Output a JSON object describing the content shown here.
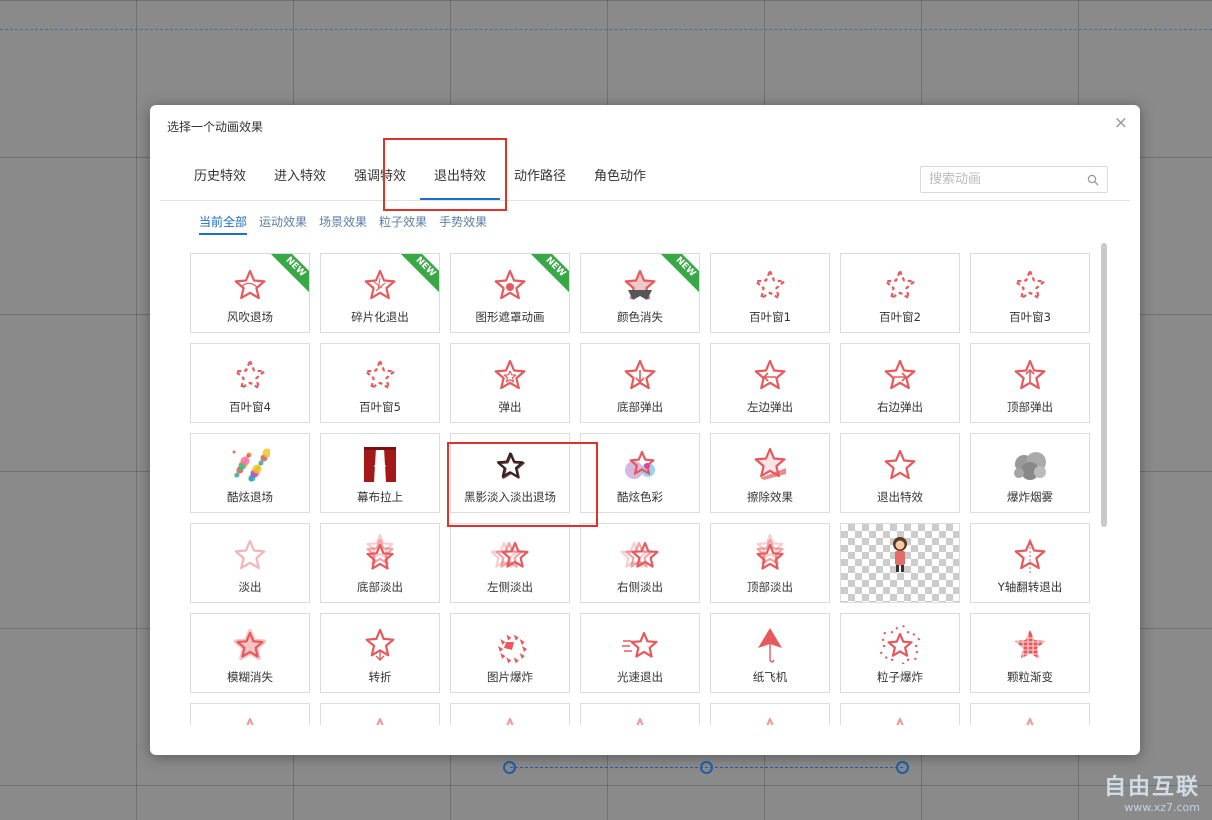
{
  "dialog": {
    "title": "选择一个动画效果",
    "close_glyph": "×",
    "tabs": [
      {
        "label": "历史特效",
        "active": false
      },
      {
        "label": "进入特效",
        "active": false
      },
      {
        "label": "强调特效",
        "active": false
      },
      {
        "label": "退出特效",
        "active": true
      },
      {
        "label": "动作路径",
        "active": false
      },
      {
        "label": "角色动作",
        "active": false
      }
    ],
    "search": {
      "placeholder": "搜索动画"
    },
    "subtabs": [
      {
        "label": "当前全部",
        "active": true
      },
      {
        "label": "运动效果",
        "active": false
      },
      {
        "label": "场景效果",
        "active": false
      },
      {
        "label": "粒子效果",
        "active": false
      },
      {
        "label": "手势效果",
        "active": false
      }
    ],
    "effects": [
      {
        "label": "风吹退场",
        "icon": "blown-star-icon",
        "new": true,
        "style": "blown"
      },
      {
        "label": "碎片化退出",
        "icon": "shattered-star-icon",
        "new": true,
        "style": "shatter"
      },
      {
        "label": "图形遮罩动画",
        "icon": "mask-star-icon",
        "new": true,
        "style": "dot"
      },
      {
        "label": "颜色消失",
        "icon": "color-fade-star-icon",
        "new": true,
        "style": "darkbottom"
      },
      {
        "label": "百叶窗1",
        "icon": "blinds-star-icon",
        "new": false,
        "style": "dashed"
      },
      {
        "label": "百叶窗2",
        "icon": "blinds-star-icon",
        "new": false,
        "style": "dashed"
      },
      {
        "label": "百叶窗3",
        "icon": "blinds-star-icon",
        "new": false,
        "style": "dashed"
      },
      {
        "label": "百叶窗4",
        "icon": "blinds-star-icon",
        "new": false,
        "style": "dashed"
      },
      {
        "label": "百叶窗5",
        "icon": "blinds-star-icon",
        "new": false,
        "style": "dashed"
      },
      {
        "label": "弹出",
        "icon": "popup-star-icon",
        "new": false,
        "style": "inner"
      },
      {
        "label": "底部弹出",
        "icon": "arrow-down-star-icon",
        "new": false,
        "style": "arrowdown"
      },
      {
        "label": "左边弹出",
        "icon": "arrow-left-star-icon",
        "new": false,
        "style": "arrowleft"
      },
      {
        "label": "右边弹出",
        "icon": "arrow-right-star-icon",
        "new": false,
        "style": "arrowright"
      },
      {
        "label": "顶部弹出",
        "icon": "arrow-up-star-icon",
        "new": false,
        "style": "arrowup"
      },
      {
        "label": "酷炫退场",
        "icon": "colorful-dots-icon",
        "new": false,
        "style": "dots"
      },
      {
        "label": "幕布拉上",
        "icon": "curtain-icon",
        "new": false,
        "style": "curtain"
      },
      {
        "label": "黑影淡入淡出退场",
        "icon": "shadow-star-icon",
        "new": false,
        "style": "shadow"
      },
      {
        "label": "酷炫色彩",
        "icon": "colorful-star-icon",
        "new": false,
        "style": "colorful"
      },
      {
        "label": "擦除效果",
        "icon": "wipe-star-icon",
        "new": false,
        "style": "wipe"
      },
      {
        "label": "退出特效",
        "icon": "exit-star-icon",
        "new": false,
        "style": "plain"
      },
      {
        "label": "爆炸烟雾",
        "icon": "smoke-explosion-icon",
        "new": false,
        "style": "smoke"
      },
      {
        "label": "淡出",
        "icon": "faded-star-icon",
        "new": false,
        "style": "faded"
      },
      {
        "label": "底部淡出",
        "icon": "stacked-stars-icon",
        "new": false,
        "style": "stackv"
      },
      {
        "label": "左侧淡出",
        "icon": "stacked-stars-icon",
        "new": false,
        "style": "stackh"
      },
      {
        "label": "右侧淡出",
        "icon": "stacked-stars-icon",
        "new": false,
        "style": "stackh"
      },
      {
        "label": "顶部淡出",
        "icon": "stacked-stars-icon",
        "new": false,
        "style": "stackv"
      },
      {
        "label": "",
        "icon": "character-figure-icon",
        "new": false,
        "style": "character"
      },
      {
        "label": "Y轴翻转退出",
        "icon": "flip-star-icon",
        "new": false,
        "style": "flip"
      },
      {
        "label": "模糊消失",
        "icon": "blur-star-icon",
        "new": false,
        "style": "blur"
      },
      {
        "label": "转折",
        "icon": "turn-star-icon",
        "new": false,
        "style": "turn"
      },
      {
        "label": "图片爆炸",
        "icon": "image-explode-icon",
        "new": false,
        "style": "explode"
      },
      {
        "label": "光速退出",
        "icon": "speed-star-icon",
        "new": false,
        "style": "speed"
      },
      {
        "label": "纸飞机",
        "icon": "paper-plane-icon",
        "new": false,
        "style": "plane"
      },
      {
        "label": "粒子爆炸",
        "icon": "particle-star-icon",
        "new": false,
        "style": "particle"
      },
      {
        "label": "颗粒渐变",
        "icon": "grain-star-icon",
        "new": false,
        "style": "grain"
      }
    ],
    "partial_row_icons": [
      "partial-effect-icon",
      "partial-effect-icon",
      "partial-effect-icon",
      "partial-effect-icon",
      "partial-effect-icon",
      "partial-effect-icon",
      "partial-effect-icon"
    ],
    "new_badge": "NEW"
  },
  "colors": {
    "accent": "#1d6fc6",
    "star": "#e8595d",
    "highlight": "#e0322a",
    "badge": "#37a845"
  },
  "watermark": {
    "brand": "自由互联",
    "site": "www.xz7.com"
  }
}
